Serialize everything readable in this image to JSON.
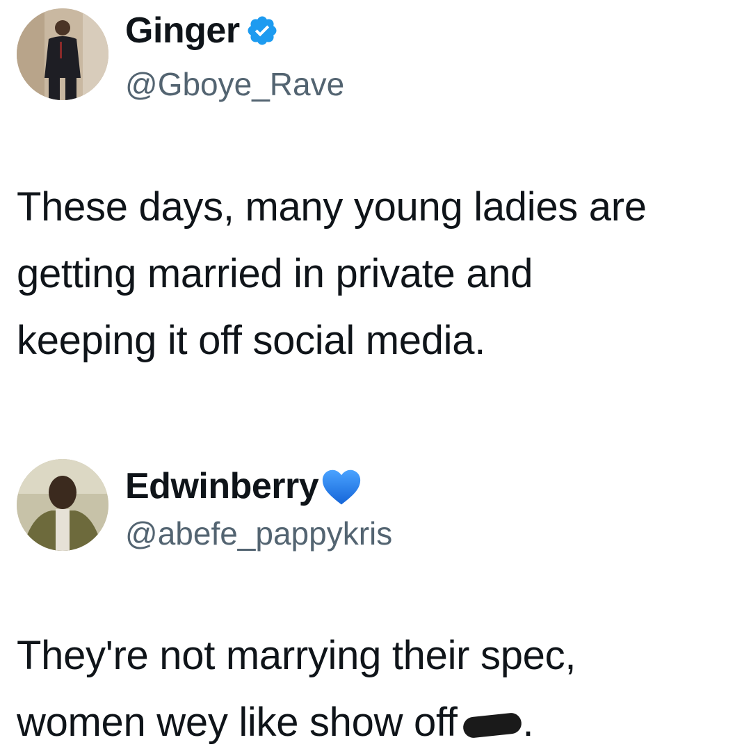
{
  "tweets": [
    {
      "display_name": "Ginger",
      "handle": "@Gboye_Rave",
      "badge": "verified-checkmark-icon",
      "badge_color": "#1d9bf0",
      "text": "These days, many young ladies are\ngetting married in private and\nkeeping it off social media."
    },
    {
      "display_name": "Edwinberry",
      "handle": "@abefe_pappykris",
      "badge": "blue-heart-icon",
      "badge_color": "#1d7cf2",
      "text_before": "They're not marrying their spec,\nwomen wey like show off",
      "text_after": "."
    }
  ],
  "colors": {
    "text": "#0f1419",
    "handle": "#536471",
    "background": "#ffffff"
  }
}
